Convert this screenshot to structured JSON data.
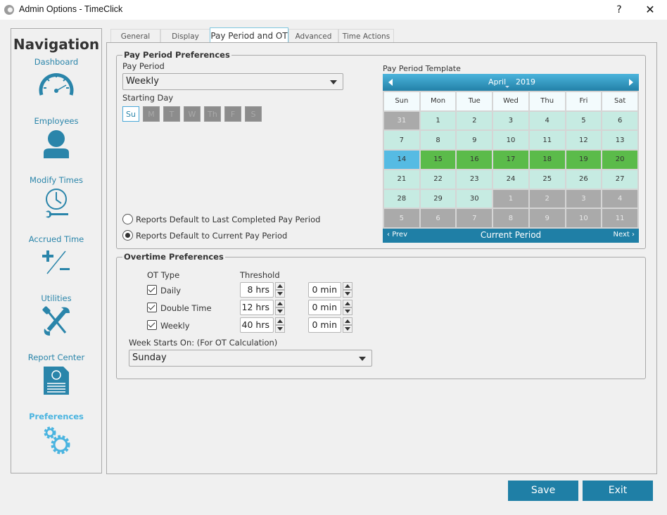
{
  "window": {
    "title": "Admin Options - TimeClick",
    "help_label": "?",
    "close_label": "✕"
  },
  "nav": {
    "heading": "Navigation",
    "items": [
      {
        "label": "Dashboard",
        "icon": "speedometer-icon"
      },
      {
        "label": "Employees",
        "icon": "person-icon"
      },
      {
        "label": "Modify Times",
        "icon": "clock-wrench-icon"
      },
      {
        "label": "Accrued Time",
        "icon": "plus-minus-icon"
      },
      {
        "label": "Utilities",
        "icon": "tools-icon"
      },
      {
        "label": "Report Center",
        "icon": "report-document-icon"
      },
      {
        "label": "Preferences",
        "icon": "gears-icon",
        "active": true
      }
    ]
  },
  "tabs": [
    {
      "label": "General"
    },
    {
      "label": "Display"
    },
    {
      "label": "Pay Period and OT",
      "active": true
    },
    {
      "label": "Advanced"
    },
    {
      "label": "Time Actions"
    }
  ],
  "pay_period": {
    "legend": "Pay Period Preferences",
    "pay_period_label": "Pay Period",
    "pay_period_value": "Weekly",
    "starting_day_label": "Starting Day",
    "days": [
      "Su",
      "M",
      "T",
      "W",
      "Th",
      "F",
      "S"
    ],
    "selected_day": "Su",
    "radios": [
      {
        "label": "Reports Default to Last Completed Pay Period",
        "checked": false
      },
      {
        "label": "Reports Default to Current Pay Period",
        "checked": true
      }
    ],
    "template_label": "Pay Period Template"
  },
  "calendar": {
    "month": "April",
    "year": "2019",
    "weekdays": [
      "Sun",
      "Mon",
      "Tue",
      "Wed",
      "Thu",
      "Fri",
      "Sat"
    ],
    "weeks": [
      [
        {
          "d": "31",
          "s": "other"
        },
        {
          "d": "1",
          "s": "cur"
        },
        {
          "d": "2",
          "s": "cur"
        },
        {
          "d": "3",
          "s": "cur"
        },
        {
          "d": "4",
          "s": "cur"
        },
        {
          "d": "5",
          "s": "cur"
        },
        {
          "d": "6",
          "s": "cur"
        }
      ],
      [
        {
          "d": "7",
          "s": "cur"
        },
        {
          "d": "8",
          "s": "cur"
        },
        {
          "d": "9",
          "s": "cur"
        },
        {
          "d": "10",
          "s": "cur"
        },
        {
          "d": "11",
          "s": "cur"
        },
        {
          "d": "12",
          "s": "cur"
        },
        {
          "d": "13",
          "s": "cur"
        }
      ],
      [
        {
          "d": "14",
          "s": "sel"
        },
        {
          "d": "15",
          "s": "period"
        },
        {
          "d": "16",
          "s": "period"
        },
        {
          "d": "17",
          "s": "period"
        },
        {
          "d": "18",
          "s": "period"
        },
        {
          "d": "19",
          "s": "period"
        },
        {
          "d": "20",
          "s": "period"
        }
      ],
      [
        {
          "d": "21",
          "s": "cur"
        },
        {
          "d": "22",
          "s": "cur"
        },
        {
          "d": "23",
          "s": "cur"
        },
        {
          "d": "24",
          "s": "cur"
        },
        {
          "d": "25",
          "s": "cur"
        },
        {
          "d": "26",
          "s": "cur"
        },
        {
          "d": "27",
          "s": "cur"
        }
      ],
      [
        {
          "d": "28",
          "s": "cur"
        },
        {
          "d": "29",
          "s": "cur"
        },
        {
          "d": "30",
          "s": "cur"
        },
        {
          "d": "1",
          "s": "other"
        },
        {
          "d": "2",
          "s": "other"
        },
        {
          "d": "3",
          "s": "other"
        },
        {
          "d": "4",
          "s": "other"
        }
      ],
      [
        {
          "d": "5",
          "s": "other"
        },
        {
          "d": "6",
          "s": "other"
        },
        {
          "d": "7",
          "s": "other"
        },
        {
          "d": "8",
          "s": "other"
        },
        {
          "d": "9",
          "s": "other"
        },
        {
          "d": "10",
          "s": "other"
        },
        {
          "d": "11",
          "s": "other"
        }
      ]
    ],
    "prev_label": "Prev",
    "current_label": "Current Period",
    "next_label": "Next"
  },
  "overtime": {
    "legend": "Overtime Preferences",
    "ot_type_header": "OT Type",
    "threshold_header": "Threshold",
    "rows": [
      {
        "label": "Daily",
        "checked": true,
        "hours": "8 hrs",
        "minutes": "0 min"
      },
      {
        "label": "Double Time",
        "checked": true,
        "hours": "12 hrs",
        "minutes": "0 min"
      },
      {
        "label": "Weekly",
        "checked": true,
        "hours": "40 hrs",
        "minutes": "0 min"
      }
    ],
    "week_starts_label": "Week Starts On: (For OT Calculation)",
    "week_starts_value": "Sunday"
  },
  "buttons": {
    "save": "Save",
    "exit": "Exit"
  },
  "colors": {
    "accent": "#1f7fa6",
    "nav_text": "#2a85aa",
    "nav_active": "#4ab4e0",
    "period_green": "#5bbb4a",
    "selected_blue": "#56bbe3",
    "current_month": "#c6ebe2"
  }
}
